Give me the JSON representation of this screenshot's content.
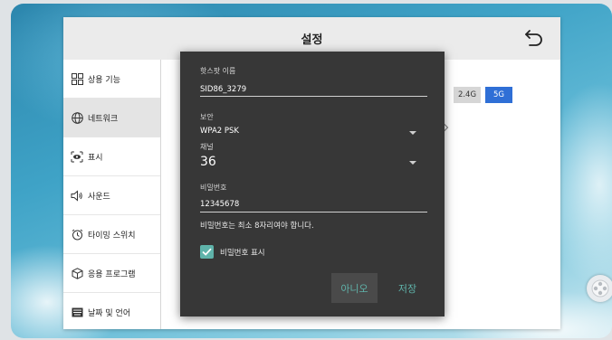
{
  "window": {
    "title": "설정"
  },
  "sidebar": {
    "items": [
      {
        "label": "상용 기능",
        "icon": "grid-icon"
      },
      {
        "label": "네트워크",
        "icon": "globe-icon"
      },
      {
        "label": "표시",
        "icon": "eye-icon"
      },
      {
        "label": "사운드",
        "icon": "speaker-icon"
      },
      {
        "label": "타이밍 스위치",
        "icon": "clock-icon"
      },
      {
        "label": "응용 프로그램",
        "icon": "cube-icon"
      },
      {
        "label": "날짜 및 언어",
        "icon": "keyboard-icon"
      }
    ]
  },
  "content": {
    "toggle_on": true,
    "bands": [
      "2.4G",
      "5G"
    ],
    "selected_band": "5G"
  },
  "dialog": {
    "ssid": {
      "label": "핫스팟 이름",
      "value": "SID86_3279"
    },
    "security": {
      "label": "보안",
      "value": "WPA2 PSK"
    },
    "channel": {
      "label": "채널",
      "value": "36"
    },
    "password": {
      "label": "비밀번호",
      "value": "12345678"
    },
    "hint": "비밀번호는 최소 8자리여야 합니다.",
    "show_password": {
      "label": "비밀번호 표시",
      "checked": true
    },
    "buttons": {
      "cancel": "아니오",
      "save": "저장"
    }
  },
  "colors": {
    "accent": "#5fb3aa",
    "toggle": "#2f6fd6",
    "dialog_bg": "#373737"
  }
}
